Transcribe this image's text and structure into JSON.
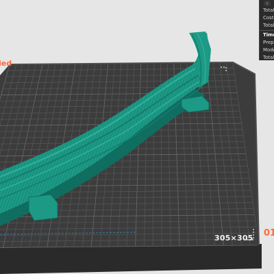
{
  "viewport": {
    "plate_corner_label_left": "led",
    "plate_corner_label_right": "01",
    "plate_size_label": "305×305"
  },
  "stats_panel": {
    "collapse_glyph": "‹",
    "rows_top": [
      "Total",
      "Cost:",
      "Total"
    ],
    "time_heading": "Time",
    "rows_bottom": [
      "Prepa",
      "Model",
      "Total"
    ]
  },
  "colors": {
    "plate": "#3d3d3d",
    "grid_line": "#5a5a5a",
    "model": "#1a9482",
    "model_dark": "#0f6e60",
    "background": "#e6e6e6",
    "accent": "#ff6a3d"
  }
}
